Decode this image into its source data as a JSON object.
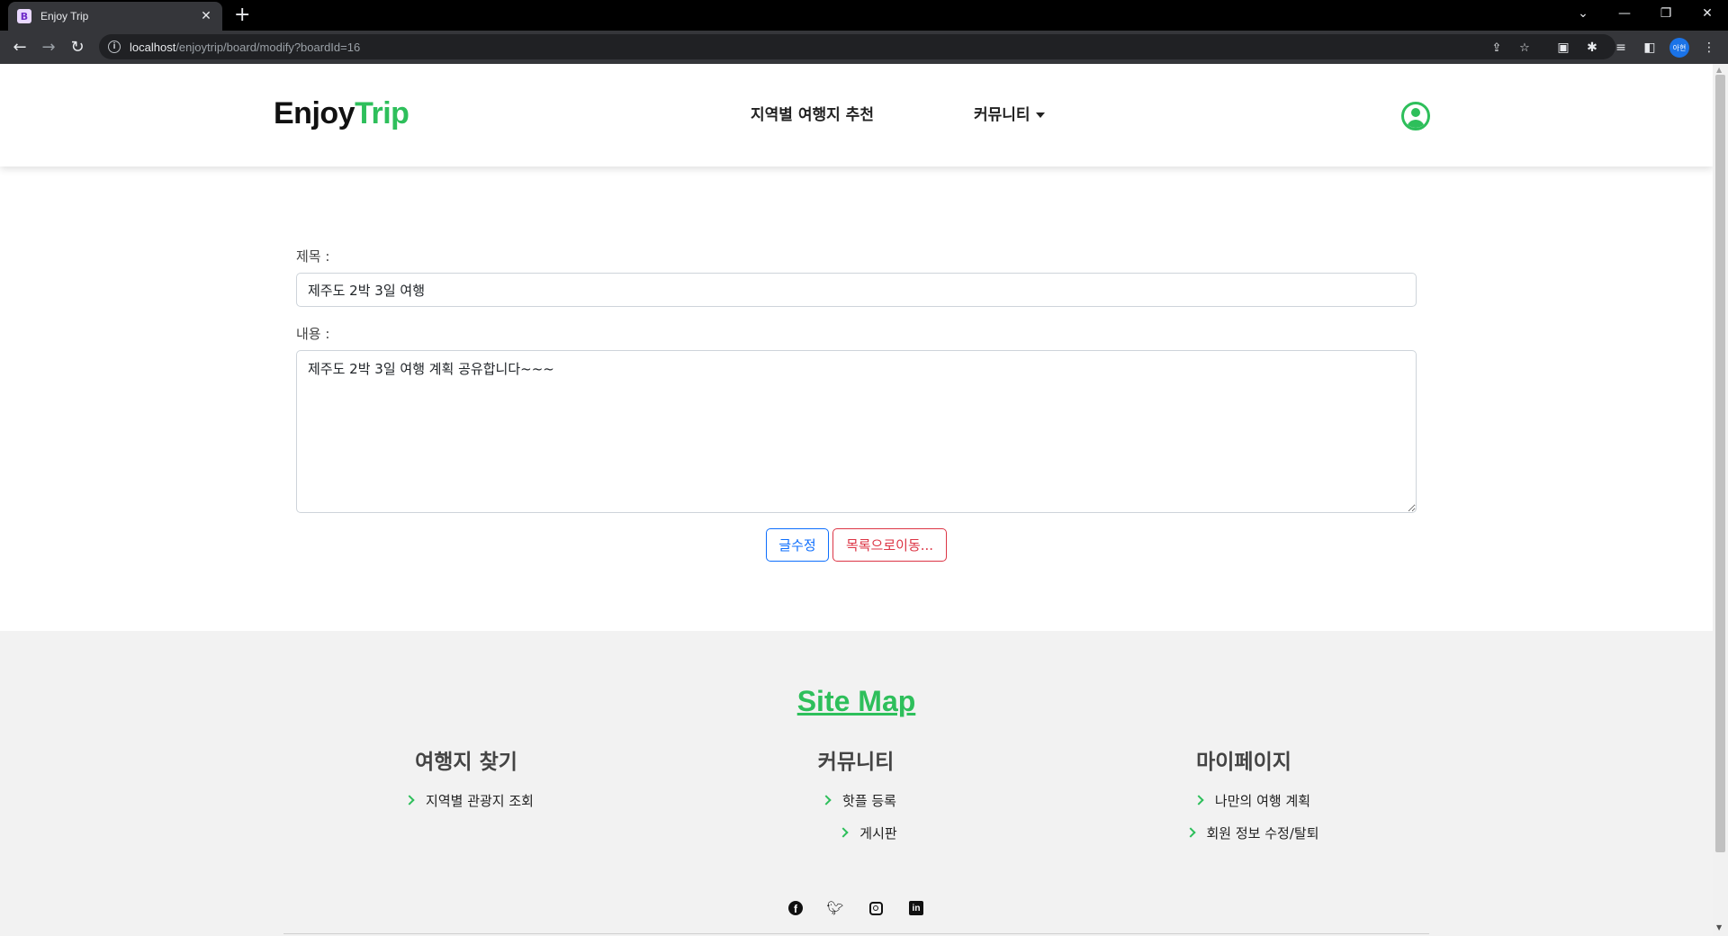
{
  "browser": {
    "tab_title": "Enjoy Trip",
    "tab_favicon": "B",
    "url_host": "localhost",
    "url_path": "/enjoytrip/board/modify?boardId=16",
    "profile_label": "아현",
    "icons": [
      "back-arrow-icon",
      "forward-arrow-icon",
      "reload-icon",
      "share-icon",
      "star-icon",
      "extensions-icon",
      "reading-list-icon",
      "side-panel-icon",
      "menu-icon"
    ]
  },
  "header": {
    "logo_main": "Enjoy",
    "logo_accent": "Trip",
    "nav": {
      "recommend": "지역별 여행지 추천",
      "community": "커뮤니티"
    }
  },
  "form": {
    "title_label": "제목 :",
    "title_value": "제주도 2박 3일 여행",
    "content_label": "내용 :",
    "content_value": "제주도 2박 3일 여행 계획 공유합니다~~~",
    "edit_button": "글수정",
    "list_button": "목록으로이동..."
  },
  "footer": {
    "sitemap_title": "Site Map",
    "columns": [
      {
        "title": "여행지 찾기",
        "items": [
          "지역별 관광지 조회"
        ]
      },
      {
        "title": "커뮤니티",
        "items": [
          "핫플 등록",
          "게시판"
        ]
      },
      {
        "title": "마이페이지",
        "items": [
          "나만의 여행 계획",
          "회원 정보 수정/탈퇴"
        ]
      }
    ],
    "social_icons": [
      "facebook-icon",
      "twitter-icon",
      "instagram-icon",
      "linkedin-icon"
    ]
  },
  "colors": {
    "accent": "#2ebf5b",
    "primary": "#0d6efd",
    "danger": "#dc3545"
  }
}
